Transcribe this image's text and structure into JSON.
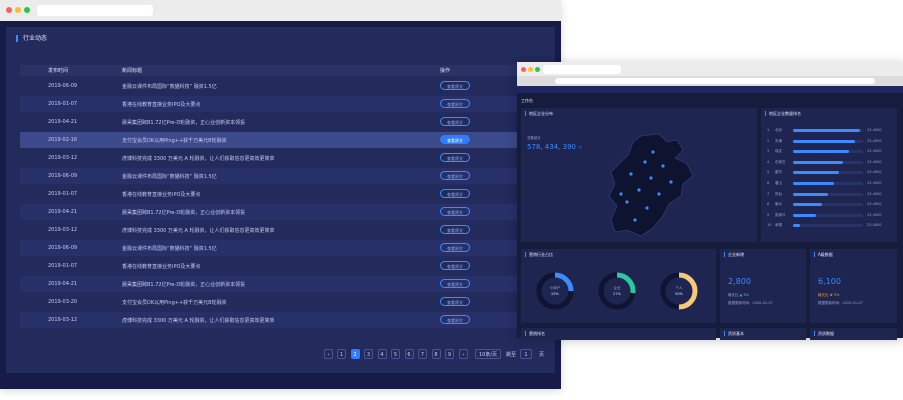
{
  "table_window": {
    "panel_title": "行业动态",
    "columns": [
      "发布时间",
      "新闻标题",
      "操作"
    ],
    "rows": [
      {
        "date": "2019-06-09",
        "title": "金融云课件布局国际“熊猫科技” 融资1.5亿",
        "action": "查看原文"
      },
      {
        "date": "2019-01-07",
        "title": "香港在线教育直接业务IPO及大要点",
        "action": "查看原文"
      },
      {
        "date": "2019-04-21",
        "title": "晨昊集团跨B1.72亿Pre-D轮融资，正心业创新资本领投",
        "action": "查看原文"
      },
      {
        "date": "2019-02-16",
        "title": "支付宝会员DK以用Ping++获千万美元B轮融资",
        "action": "查看原文"
      },
      {
        "date": "2019-03-12",
        "title": "虎博科技完成 3300 万美元 A 轮融资，让人们获取信息更高效更简单",
        "action": "查看原文"
      },
      {
        "date": "2019-06-09",
        "title": "金融云课件布局国际“熊猫科技” 融资1.5亿",
        "action": "查看原文"
      },
      {
        "date": "2019-01-07",
        "title": "香港在线教育直接业务IPO及大要点",
        "action": "查看原文"
      },
      {
        "date": "2019-04-21",
        "title": "晨昊集团跨B1.72亿Pre-D轮融资，正心业创新资本领投",
        "action": "查看原文"
      },
      {
        "date": "2019-03-12",
        "title": "虎博科技完成 3300 万美元 A 轮融资，让人们获取信息更高效更简单",
        "action": "查看原文"
      },
      {
        "date": "2019-06-09",
        "title": "金融云课件布局国际“熊猫科技” 融资1.5亿",
        "action": "查看原文"
      },
      {
        "date": "2019-01-07",
        "title": "香港在线教育直接业务IPO及大要点",
        "action": "查看原文"
      },
      {
        "date": "2019-04-21",
        "title": "晨昊集团跨B1.72亿Pre-D轮融资，正心业创新资本领投",
        "action": "查看原文"
      },
      {
        "date": "2019-03-20",
        "title": "支付宝会员DK以用Ping++获千万美元B轮融资",
        "action": "查看原文"
      },
      {
        "date": "2019-03-12",
        "title": "虎博科技完成 3300 万美元 A 轮融资，让人们获取信息更高效更简单",
        "action": "查看原文"
      }
    ],
    "selected_row": 3,
    "pagination": {
      "prev": "‹",
      "next": "›",
      "pages": [
        "1",
        "2",
        "3",
        "4",
        "5",
        "6",
        "7",
        "8",
        "9"
      ],
      "current": "2",
      "page_size": "10条/页",
      "goto_label": "跳至",
      "goto_value": "1",
      "goto_suffix": "页"
    }
  },
  "dashboard_window": {
    "header": "工作台",
    "map_card": {
      "title": "地区企业分布",
      "label": "总数统计",
      "value": "578, 434, 390",
      "unit": "个"
    },
    "ranking_card": {
      "title": "地区企业数量排名",
      "items": [
        {
          "rank": "1",
          "name": "北京",
          "value": "23,4000",
          "fill": 0.95
        },
        {
          "rank": "2",
          "name": "天津",
          "value": "23,4000",
          "fill": 0.88
        },
        {
          "rank": "3",
          "name": "保定",
          "value": "23,4000",
          "fill": 0.8
        },
        {
          "rank": "4",
          "name": "石家庄",
          "value": "23,4000",
          "fill": 0.72
        },
        {
          "rank": "5",
          "name": "廊坊",
          "value": "23,4000",
          "fill": 0.65
        },
        {
          "rank": "6",
          "name": "唐山",
          "value": "23,4000",
          "fill": 0.58
        },
        {
          "rank": "7",
          "name": "邢台",
          "value": "23,4000",
          "fill": 0.5
        },
        {
          "rank": "8",
          "name": "衡水",
          "value": "23,4000",
          "fill": 0.42
        },
        {
          "rank": "9",
          "name": "张家口",
          "value": "23,4000",
          "fill": 0.33
        },
        {
          "rank": "10",
          "name": "承德",
          "value": "23,4000",
          "fill": 0.1
        }
      ]
    },
    "donut_card": {
      "title": "营销行业占比",
      "donuts": [
        {
          "label": "小商户",
          "value": "25%",
          "fraction": 0.25,
          "color": "#3d8bff"
        },
        {
          "label": "企业",
          "value": "27%",
          "fraction": 0.27,
          "color": "#2fc7a0"
        },
        {
          "label": "个人",
          "value": "50%",
          "fraction": 0.5,
          "color": "#f5c97a"
        }
      ]
    },
    "stat_card_1": {
      "title": "企业新增",
      "value": "2,800",
      "growth_label": "增长比",
      "growth": "5%",
      "date_label": "数据更新时间：2020-01-07"
    },
    "stat_card_2": {
      "title": "A级数据",
      "value": "6,100",
      "growth_label": "增长比",
      "growth": "5%",
      "date_label": "数据更新时间：2020-01-07"
    },
    "bottom_titles": [
      "营销排名",
      "资质基本",
      "资质数据"
    ],
    "accent": "#3d8bff"
  }
}
